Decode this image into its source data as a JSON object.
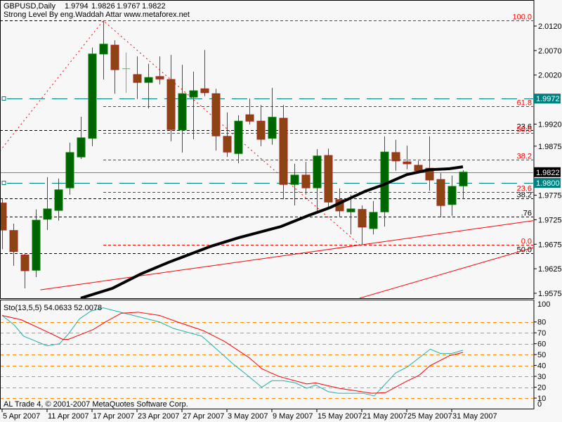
{
  "header": {
    "symbol": "GBPUSD,Daily",
    "open": "1.9794",
    "high": "1.9826",
    "low": "1.9767",
    "close": "1.9822",
    "subtitle": "Strong Level By eng.Waddah Attar www.metaforex.net"
  },
  "footer": "AL Trade 4, © 2001-2007 MetaQuotes Software Corp.",
  "colors": {
    "background": "#f7f7f7",
    "bull_body": "#006400",
    "bull_outline": "#008000",
    "bear_body": "#8b4513",
    "bear_outline": "#b22222",
    "doji": "#00ff00",
    "ma": "#000000",
    "fib": "#ff0000",
    "level": "#000000",
    "teal": "#008080",
    "bid": "#808080",
    "stoch_main": "#20b2aa",
    "stoch_signal": "#ff0000",
    "stoch_levels": "#ff8c00"
  },
  "chart_data": [
    {
      "type": "candlestick",
      "title": "GBPUSD,Daily",
      "ylim": [
        1.955,
        2.018
      ],
      "y_ticks": [
        "2.0120",
        "2.0070",
        "2.0020",
        "1.9920",
        "1.9875",
        "1.9775",
        "1.9725",
        "1.9675",
        "1.9625",
        "1.9575"
      ],
      "x_ticks": [
        {
          "bar": 0,
          "label": "5 Apr 2007"
        },
        {
          "bar": 4,
          "label": "11 Apr 2007"
        },
        {
          "bar": 8,
          "label": "17 Apr 2007"
        },
        {
          "bar": 12,
          "label": "23 Apr 2007"
        },
        {
          "bar": 16,
          "label": "27 Apr 2007"
        },
        {
          "bar": 20,
          "label": "3 May 2007"
        },
        {
          "bar": 24,
          "label": "9 May 2007"
        },
        {
          "bar": 28,
          "label": "15 May 2007"
        },
        {
          "bar": 32,
          "label": "21 May 2007"
        },
        {
          "bar": 36,
          "label": "25 May 2007"
        },
        {
          "bar": 40,
          "label": "31 May 2007"
        }
      ],
      "ohlc": [
        [
          1.9759,
          1.9767,
          1.9665,
          1.9704
        ],
        [
          1.9703,
          1.9717,
          1.9631,
          1.966
        ],
        [
          1.9653,
          1.9657,
          1.9585,
          1.9621
        ],
        [
          1.9622,
          1.9746,
          1.9608,
          1.9724
        ],
        [
          1.9726,
          1.9812,
          1.9704,
          1.9747
        ],
        [
          1.9744,
          1.9809,
          1.9723,
          1.9786
        ],
        [
          1.979,
          1.9882,
          1.9776,
          1.9862
        ],
        [
          1.9853,
          1.9935,
          1.9849,
          1.9892
        ],
        [
          1.9891,
          2.0076,
          1.9875,
          2.0063
        ],
        [
          2.0063,
          2.013,
          2.0011,
          2.0083
        ],
        [
          2.0081,
          2.0091,
          1.9982,
          2.0031
        ],
        [
          2.0033,
          2.0066,
          1.9984,
          2.0033
        ],
        [
          2.0021,
          2.0058,
          1.9971,
          2.0005
        ],
        [
          2.0005,
          2.0043,
          1.9952,
          2.0015
        ],
        [
          2.0017,
          2.0058,
          2.0001,
          2.0012
        ],
        [
          2.0011,
          2.0061,
          1.9885,
          1.9909
        ],
        [
          1.9908,
          2.0041,
          1.9862,
          1.9982
        ],
        [
          1.9975,
          2.0027,
          1.9889,
          1.9988
        ],
        [
          1.9992,
          2.0071,
          1.9977,
          1.9984
        ],
        [
          1.9982,
          1.9992,
          1.9866,
          1.9896
        ],
        [
          1.9895,
          1.9944,
          1.9853,
          1.9863
        ],
        [
          1.986,
          1.9938,
          1.984,
          1.9926
        ],
        [
          1.9939,
          1.9972,
          1.9919,
          1.9926
        ],
        [
          1.9926,
          1.9959,
          1.9875,
          1.9889
        ],
        [
          1.9891,
          1.9994,
          1.9878,
          1.9934
        ],
        [
          1.9932,
          1.9959,
          1.9767,
          1.9797
        ],
        [
          1.9797,
          1.9839,
          1.9754,
          1.9816
        ],
        [
          1.9816,
          1.9843,
          1.9776,
          1.979
        ],
        [
          1.979,
          1.9869,
          1.9743,
          1.9855
        ],
        [
          1.9856,
          1.987,
          1.9751,
          1.9761
        ],
        [
          1.9766,
          1.9789,
          1.973,
          1.9743
        ],
        [
          1.9741,
          1.9776,
          1.9695,
          1.9747
        ],
        [
          1.9746,
          1.9754,
          1.9675,
          1.971
        ],
        [
          1.9707,
          1.9763,
          1.9695,
          1.974
        ],
        [
          1.9741,
          1.9895,
          1.9711,
          1.9863
        ],
        [
          1.9862,
          1.9888,
          1.9825,
          1.9845
        ],
        [
          1.9843,
          1.9876,
          1.9828,
          1.9839
        ],
        [
          1.9836,
          1.9845,
          1.982,
          1.9825
        ],
        [
          1.983,
          1.9895,
          1.9784,
          1.9806
        ],
        [
          1.9807,
          1.982,
          1.973,
          1.9754
        ],
        [
          1.9756,
          1.9815,
          1.9733,
          1.9793
        ],
        [
          1.9794,
          1.9826,
          1.9767,
          1.9822
        ]
      ],
      "moving_average": [
        [
          7,
          1.9565
        ],
        [
          9.8,
          1.9585
        ],
        [
          12.3,
          1.9614
        ],
        [
          14.8,
          1.9638
        ],
        [
          18.6,
          1.9671
        ],
        [
          21,
          1.9688
        ],
        [
          24.8,
          1.9711
        ],
        [
          27.3,
          1.9734
        ],
        [
          29.2,
          1.975
        ],
        [
          32.3,
          1.9783
        ],
        [
          34,
          1.9797
        ],
        [
          36,
          1.9817
        ],
        [
          38,
          1.9827
        ],
        [
          39.8,
          1.9829
        ],
        [
          41,
          1.9833
        ]
      ],
      "fib_levels": [
        {
          "label": "100.0",
          "price": 2.0131
        },
        {
          "label": "61.8",
          "price": 1.9957
        },
        {
          "label": "50.0",
          "price": 1.9902
        },
        {
          "label": "38.2",
          "price": 1.9848
        },
        {
          "label": "23.6",
          "price": 1.9782
        },
        {
          "label": "0.0",
          "price": 1.9674
        }
      ],
      "strong_levels": [
        {
          "label": "",
          "price": 2.0131
        },
        {
          "label": "23.6",
          "price": 1.9908
        },
        {
          "label": "38.2",
          "price": 1.9769
        },
        {
          "label": ".76",
          "price": 1.9731
        },
        {
          "label": "50.0",
          "price": 1.9657
        }
      ],
      "fib_swing": [
        [
          -0.2,
          1.9865
        ],
        [
          9,
          2.0131
        ],
        [
          31.8,
          1.9674
        ]
      ],
      "trendlines": [
        [
          [
            3.4,
            1.9582
          ],
          [
            47.25,
            1.9723
          ]
        ],
        [
          [
            31.8,
            1.9565
          ],
          [
            47.25,
            1.9668
          ]
        ]
      ],
      "horizontal_lines": [
        {
          "label": "1.9972",
          "price": 1.9972,
          "style": "teal"
        },
        {
          "label": "1.9800",
          "price": 1.98,
          "style": "teal"
        }
      ],
      "bid_line": {
        "label": "1.9822",
        "price": 1.9822
      }
    },
    {
      "type": "line",
      "title": "Sto(13,5,5) 54.0633 52.0078",
      "ylim": [
        0,
        100
      ],
      "y_ticks": [
        "100",
        "80",
        "70",
        "60",
        "50",
        "40",
        "30",
        "20",
        "10",
        "0"
      ],
      "levels": [
        10,
        20,
        30,
        40,
        50,
        60,
        70,
        80
      ],
      "series": [
        {
          "name": "main",
          "points": [
            [
              0,
              86
            ],
            [
              1.1,
              77
            ],
            [
              1.9,
              67
            ],
            [
              4,
              58
            ],
            [
              5.1,
              60
            ],
            [
              5.9,
              69
            ],
            [
              6.9,
              83
            ],
            [
              7.9,
              90
            ],
            [
              9,
              93
            ],
            [
              10.9,
              88
            ],
            [
              14,
              80
            ],
            [
              15.25,
              74
            ],
            [
              17.75,
              67
            ],
            [
              18.1,
              64
            ],
            [
              20.6,
              41
            ],
            [
              21.7,
              32
            ],
            [
              23.1,
              20
            ],
            [
              24,
              26
            ],
            [
              25,
              26
            ],
            [
              26.1,
              24
            ],
            [
              27.1,
              19
            ],
            [
              27.9,
              22
            ],
            [
              29,
              16
            ],
            [
              29.9,
              14.5
            ],
            [
              32.1,
              14.5
            ],
            [
              33.1,
              12
            ],
            [
              35,
              33
            ],
            [
              36.1,
              39
            ],
            [
              38.1,
              55
            ],
            [
              39,
              51
            ],
            [
              40,
              51
            ],
            [
              41,
              54.06
            ]
          ]
        },
        {
          "name": "signal",
          "points": [
            [
              0,
              86
            ],
            [
              1.7,
              82
            ],
            [
              4,
              71
            ],
            [
              5.4,
              64
            ],
            [
              5.9,
              64
            ],
            [
              8.1,
              73
            ],
            [
              9.2,
              80
            ],
            [
              10.6,
              88
            ],
            [
              12.1,
              89
            ],
            [
              14,
              86
            ],
            [
              15.6,
              80
            ],
            [
              17.9,
              72
            ],
            [
              19.8,
              62
            ],
            [
              22,
              47
            ],
            [
              23.1,
              37
            ],
            [
              24.6,
              30
            ],
            [
              27.1,
              23
            ],
            [
              27.9,
              24
            ],
            [
              30,
              19
            ],
            [
              32.9,
              14.5
            ],
            [
              34.1,
              15
            ],
            [
              35.9,
              25
            ],
            [
              37.1,
              31
            ],
            [
              38.1,
              40
            ],
            [
              39.8,
              49
            ],
            [
              41,
              52.01
            ]
          ]
        }
      ]
    }
  ]
}
